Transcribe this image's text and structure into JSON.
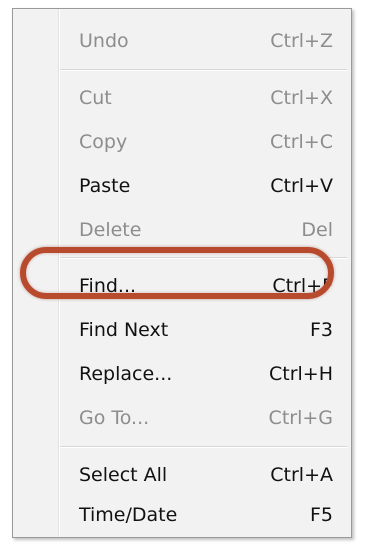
{
  "menu": {
    "items": [
      {
        "label": "Undo",
        "shortcut": "Ctrl+Z",
        "enabled": false
      },
      {
        "label": "Cut",
        "shortcut": "Ctrl+X",
        "enabled": false
      },
      {
        "label": "Copy",
        "shortcut": "Ctrl+C",
        "enabled": false
      },
      {
        "label": "Paste",
        "shortcut": "Ctrl+V",
        "enabled": true
      },
      {
        "label": "Delete",
        "shortcut": "Del",
        "enabled": false
      },
      {
        "label": "Find...",
        "shortcut": "Ctrl+F",
        "enabled": true,
        "highlighted": true
      },
      {
        "label": "Find Next",
        "shortcut": "F3",
        "enabled": true
      },
      {
        "label": "Replace...",
        "shortcut": "Ctrl+H",
        "enabled": true
      },
      {
        "label": "Go To...",
        "shortcut": "Ctrl+G",
        "enabled": false
      },
      {
        "label": "Select All",
        "shortcut": "Ctrl+A",
        "enabled": true
      },
      {
        "label": "Time/Date",
        "shortcut": "F5",
        "enabled": true
      }
    ]
  },
  "annotation": {
    "highlight_color": "#b84a2e",
    "target": "Find..."
  }
}
